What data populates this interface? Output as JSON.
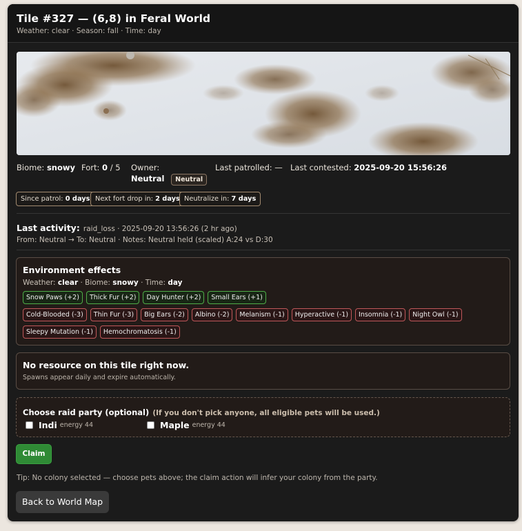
{
  "header": {
    "title": "Tile #327 — (6,8) in Feral World",
    "subtitle": "Weather: clear · Season: fall · Time: day"
  },
  "info": {
    "biome_label": "Biome:",
    "biome": "snowy",
    "fort_label": "Fort:",
    "fort_current": "0",
    "fort_max": "/ 5",
    "owner_label": "Owner:",
    "owner": "Neutral",
    "owner_badge": "Neutral",
    "patrolled_label": "Last patrolled: —",
    "contested_label": "Last contested:",
    "contested": "2025-09-20 15:56:26"
  },
  "chips": {
    "since_patrol_label": "Since patrol:",
    "since_patrol": "0 days",
    "fort_drop_label": "Next fort drop in:",
    "fort_drop": "2 days",
    "neutralize_label": "Neutralize in:",
    "neutralize": "7 days"
  },
  "activity": {
    "label": "Last activity:",
    "meta": "raid_loss · 2025-09-20 13:56:26 (2 hr ago)",
    "line2": "From: Neutral → To: Neutral · Notes: Neutral held (scaled) A:24 vs D:30"
  },
  "environment": {
    "title": "Environment effects",
    "weather_label": "Weather:",
    "weather": "clear",
    "biome_label": "· Biome:",
    "biome": "snowy",
    "time_label": "· Time:",
    "time": "day",
    "positive": [
      "Snow Paws (+2)",
      "Thick Fur (+2)",
      "Day Hunter (+2)",
      "Small Ears (+1)"
    ],
    "negative_row1": [
      "Cold-Blooded (-3)",
      "Thin Fur (-3)",
      "Big Ears (-2)",
      "Albino (-2)",
      "Melanism (-1)",
      "Hyperactive (-1)",
      "Insomnia (-1)",
      "Night Owl (-1)"
    ],
    "negative_row2": [
      "Sleepy Mutation (-1)",
      "Hemochromatosis (-1)"
    ],
    "colors": {
      "positive_border": "#4fae48",
      "negative_border": "#c0585a"
    }
  },
  "resource": {
    "title": "No resource on this tile right now.",
    "note": "Spawns appear daily and expire automatically."
  },
  "raid": {
    "title": "Choose raid party (optional)",
    "hint": "(If you don't pick anyone, all eligible pets will be used.)",
    "pets": [
      {
        "name": "Indi",
        "energy": "energy 44"
      },
      {
        "name": "Maple",
        "energy": "energy 44"
      }
    ]
  },
  "actions": {
    "claim_label": "Claim",
    "tip": "Tip: No colony selected — choose pets above; the claim action will infer your colony from the party.",
    "back_label": "Back to World Map",
    "claim_color": "#2f8a35"
  }
}
